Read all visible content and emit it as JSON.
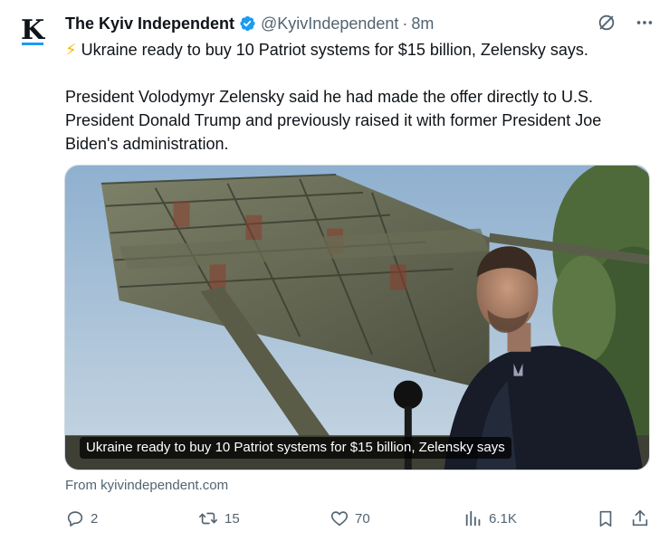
{
  "tweet": {
    "avatar_letter": "K",
    "display_name": "The Kyiv Independent",
    "handle": "@KyivIndependent",
    "separator": "·",
    "time": "8m",
    "headline_emoji": "⚡",
    "headline": "Ukraine ready to buy 10 Patriot systems for $15 billion, Zelensky says.",
    "body": "President Volodymyr Zelensky said he had made the offer directly to U.S. President Donald Trump and previously raised it with former President Joe Biden's administration.",
    "media_caption": "Ukraine ready to buy 10 Patriot systems for $15 billion, Zelensky says",
    "source": "From kyivindependent.com"
  },
  "actions": {
    "replies": "2",
    "reposts": "15",
    "likes": "70",
    "views": "6.1K"
  },
  "icons": {
    "verified": "verified-badge-icon",
    "grok": "grok-icon",
    "more": "more-icon",
    "reply": "reply-icon",
    "repost": "repost-icon",
    "like": "like-icon",
    "views": "views-icon",
    "bookmark": "bookmark-icon",
    "share": "share-icon"
  },
  "colors": {
    "accent": "#1d9bf0",
    "text": "#0f1419",
    "secondary": "#536471"
  }
}
